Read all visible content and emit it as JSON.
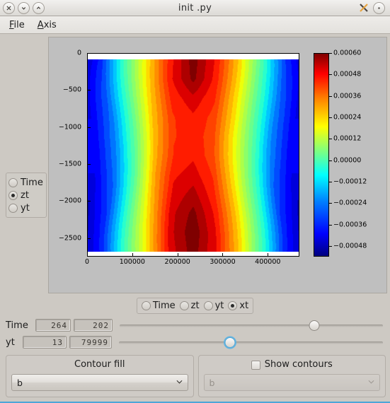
{
  "window": {
    "title": "__init__.py",
    "title_display": "init  .py",
    "controls": {
      "close": "close-button",
      "minimize": "minimize-button",
      "maximize": "maximize-button",
      "app_icon": "application-icon",
      "menu_button": "window-menu-button"
    }
  },
  "menubar": {
    "items": [
      {
        "label": "File",
        "accel": "F",
        "rest": "ile"
      },
      {
        "label": "Axis",
        "accel": "A",
        "rest": "xis"
      }
    ]
  },
  "left_radio_group": {
    "name": "vertical-axis-selector",
    "options": [
      {
        "label": "Time",
        "selected": false
      },
      {
        "label": "zt",
        "selected": true
      },
      {
        "label": "yt",
        "selected": false
      }
    ],
    "selected": "zt"
  },
  "bottom_radio_group": {
    "name": "horizontal-axis-selector",
    "options": [
      {
        "label": "Time",
        "selected": false
      },
      {
        "label": "zt",
        "selected": false
      },
      {
        "label": "yt",
        "selected": false
      },
      {
        "label": "xt",
        "selected": true
      }
    ],
    "selected": "xt"
  },
  "sliders": [
    {
      "label": "Time",
      "index_value": "264",
      "value": "202",
      "position_pct": 74,
      "focused": false
    },
    {
      "label": "yt",
      "index_value": "13",
      "value": "79999",
      "position_pct": 42,
      "focused": true
    }
  ],
  "contour_fill_group": {
    "title": "Contour fill",
    "selected": "b",
    "chevron": "⌄",
    "enabled": true
  },
  "show_contours_group": {
    "title": "Show contours",
    "checked": false,
    "selected": "b",
    "chevron": "⌄",
    "enabled": false
  },
  "chart_data": {
    "type": "heatmap",
    "title": "",
    "xlabel": "",
    "ylabel": "",
    "colormap": "jet",
    "grid": false,
    "xlim": [
      0,
      470000
    ],
    "ylim": [
      -2750,
      0
    ],
    "xticks": [
      0,
      100000,
      200000,
      300000,
      400000
    ],
    "xticklabels": [
      "0",
      "100000",
      "200000",
      "300000",
      "400000"
    ],
    "yticks": [
      0,
      -500,
      -1000,
      -1500,
      -2000,
      -2500
    ],
    "yticklabels": [
      "0",
      "−500",
      "−1000",
      "−1500",
      "−2000",
      "−2500"
    ],
    "colorbar": {
      "ticks": [
        0.0006,
        0.00048,
        0.00036,
        0.00024,
        0.00012,
        0.0,
        -0.00012,
        -0.00024,
        -0.00036,
        -0.00048
      ],
      "ticklabels": [
        "0.00060",
        "0.00048",
        "0.00036",
        "0.00024",
        "0.00012",
        "0.00000",
        "−0.00012",
        "−0.00024",
        "−0.00036",
        "−0.00048"
      ],
      "vmin": -0.00054,
      "vmax": 0.0006,
      "position": "right"
    },
    "description": "Filled contour of variable b over x (0-470000) and depth (0 to -2750); vertical blue-to-red jet bands with a warm core near x=230000 and dark-red maxima near the top and bottom of the central band.",
    "x": [
      0,
      47000,
      94000,
      141000,
      188000,
      235000,
      282000,
      329000,
      376000,
      423000,
      470000
    ],
    "y": [
      0,
      -275,
      -550,
      -825,
      -1100,
      -1375,
      -1650,
      -1925,
      -2200,
      -2475,
      -2750
    ],
    "z": [
      [
        -0.00052,
        -0.00034,
        -5e-05,
        0.00022,
        0.00045,
        0.00058,
        0.00046,
        0.00024,
        -4e-05,
        -0.00032,
        -0.0005
      ],
      [
        -0.00048,
        -0.00031,
        -4e-05,
        0.00023,
        0.00046,
        0.00057,
        0.00045,
        0.00023,
        -4e-05,
        -0.0003,
        -0.00047
      ],
      [
        -0.00044,
        -0.00028,
        -3e-05,
        0.00024,
        0.00044,
        0.0005,
        0.00043,
        0.00022,
        -3e-05,
        -0.00027,
        -0.00044
      ],
      [
        -0.00041,
        -0.00026,
        -2e-05,
        0.00025,
        0.00042,
        0.00046,
        0.00041,
        0.00022,
        -2e-05,
        -0.00025,
        -0.00041
      ],
      [
        -0.00039,
        -0.00024,
        -1e-05,
        0.00026,
        0.00042,
        0.00045,
        0.0004,
        0.00021,
        -1e-05,
        -0.00024,
        -0.00039
      ],
      [
        -0.00039,
        -0.00024,
        -1e-05,
        0.00027,
        0.00043,
        0.00046,
        0.0004,
        0.00021,
        -1e-05,
        -0.00024,
        -0.00039
      ],
      [
        -0.00041,
        -0.00026,
        -2e-05,
        0.00028,
        0.00046,
        0.00049,
        0.00042,
        0.00022,
        -2e-05,
        -0.00026,
        -0.00041
      ],
      [
        -0.00044,
        -0.00029,
        -3e-05,
        0.00027,
        0.00048,
        0.00053,
        0.00044,
        0.00023,
        -3e-05,
        -0.00029,
        -0.00044
      ],
      [
        -0.00048,
        -0.00032,
        -4e-05,
        0.00025,
        0.0005,
        0.00057,
        0.00046,
        0.00024,
        -4e-05,
        -0.00032,
        -0.00048
      ],
      [
        -0.00051,
        -0.00034,
        -5e-05,
        0.00023,
        0.0005,
        0.00059,
        0.00047,
        0.00024,
        -5e-05,
        -0.00034,
        -0.00051
      ],
      [
        -0.00052,
        -0.00035,
        -6e-05,
        0.00022,
        0.00049,
        0.00058,
        0.00047,
        0.00024,
        -6e-05,
        -0.00035,
        -0.00052
      ]
    ]
  }
}
